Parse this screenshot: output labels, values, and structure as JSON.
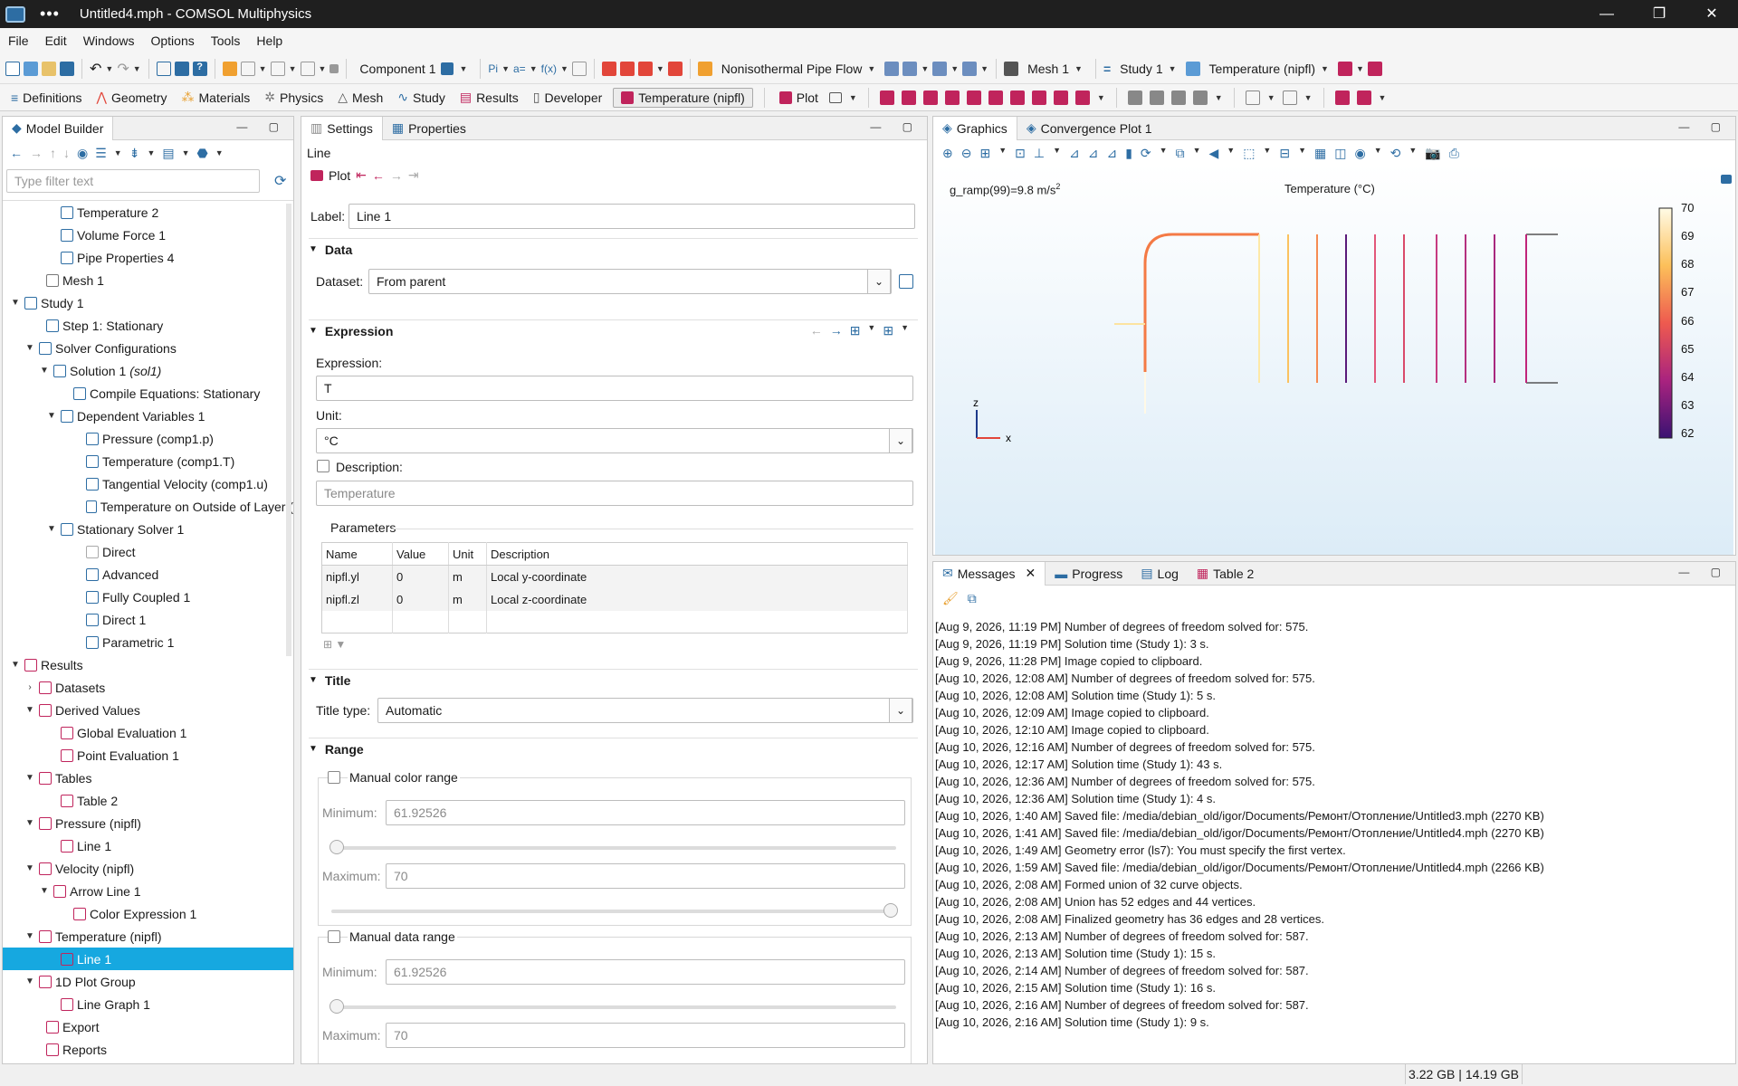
{
  "window": {
    "title": "Untitled4.mph - COMSOL Multiphysics",
    "dots": "•••",
    "min": "—",
    "max": "❐",
    "close": "✕"
  },
  "menu": [
    "File",
    "Edit",
    "Windows",
    "Options",
    "Tools",
    "Help"
  ],
  "toolbar": {
    "component": "Component 1",
    "physics": "Nonisothermal Pipe Flow",
    "mesh": "Mesh 1",
    "study": "Study 1",
    "plot": "Temperature (nipfl)"
  },
  "ribbon": {
    "tabs": [
      "Definitions",
      "Geometry",
      "Materials",
      "Physics",
      "Mesh",
      "Study",
      "Results",
      "Developer",
      "Temperature (nipfl)",
      "Plot"
    ]
  },
  "model_builder": {
    "title": "Model Builder",
    "filter_placeholder": "Type filter text",
    "nodes": [
      "Temperature 2",
      "Volume Force 1",
      "Pipe Properties 4",
      "Mesh 1",
      "Study 1",
      "Step 1: Stationary",
      "Solver Configurations",
      "Solution 1",
      "Compile Equations: Stationary",
      "Dependent Variables 1",
      "Pressure (comp1.p)",
      "Temperature (comp1.T)",
      "Tangential Velocity (comp1.u)",
      "Temperature on Outside of Layer (",
      "Stationary Solver 1",
      "Direct",
      "Advanced",
      "Fully Coupled 1",
      "Direct 1",
      "Parametric 1",
      "Results",
      "Datasets",
      "Derived Values",
      "Global Evaluation 1",
      "Point Evaluation 1",
      "Tables",
      "Table 2",
      "Pressure (nipfl)",
      "Line 1",
      "Velocity (nipfl)",
      "Arrow Line 1",
      "Color Expression 1",
      "Temperature (nipfl)",
      "Line 1",
      "1D Plot Group",
      "Line Graph 1",
      "Export",
      "Reports"
    ],
    "sol_tag": "(sol1)"
  },
  "settings": {
    "tabs": [
      "Settings",
      "Properties"
    ],
    "node_type": "Line",
    "plot_label": "Plot",
    "label_caption": "Label:",
    "label_value": "Line 1",
    "data_section": "Data",
    "dataset_caption": "Dataset:",
    "dataset_value": "From parent",
    "expression_section": "Expression",
    "expression_caption": "Expression:",
    "expression_value": "T",
    "unit_caption": "Unit:",
    "unit_value": "°C",
    "description_caption": "Description:",
    "description_value": "Temperature",
    "parameters_caption": "Parameters",
    "param_headers": [
      "Name",
      "Value",
      "Unit",
      "Description"
    ],
    "params": [
      [
        "nipfl.yl",
        "0",
        "m",
        "Local y-coordinate"
      ],
      [
        "nipfl.zl",
        "0",
        "m",
        "Local z-coordinate"
      ]
    ],
    "title_section": "Title",
    "title_type_caption": "Title type:",
    "title_type_value": "Automatic",
    "range_section": "Range",
    "manual_color_range": "Manual color range",
    "manual_data_range": "Manual data range",
    "min_caption": "Minimum:",
    "max_caption": "Maximum:",
    "min_value": "61.92526",
    "max_value": "70"
  },
  "graphics": {
    "tabs": [
      "Graphics",
      "Convergence Plot 1"
    ],
    "gravity_label": "g_ramp(99)=9.8 m/s",
    "gravity_exp": "2",
    "plot_title": "Temperature (°C)",
    "colorbar_ticks": [
      "70",
      "69",
      "68",
      "67",
      "66",
      "65",
      "64",
      "63",
      "62"
    ],
    "axis_z": "z",
    "axis_x": "x"
  },
  "messages": {
    "tabs": [
      "Messages",
      "Progress",
      "Log",
      "Table 2"
    ],
    "lines": [
      "[Aug 9, 2026, 11:19 PM] Number of degrees of freedom solved for: 575.",
      "[Aug 9, 2026, 11:19 PM] Solution time (Study 1): 3 s.",
      "[Aug 9, 2026, 11:28 PM] Image copied to clipboard.",
      "[Aug 10, 2026, 12:08 AM] Number of degrees of freedom solved for: 575.",
      "[Aug 10, 2026, 12:08 AM] Solution time (Study 1): 5 s.",
      "[Aug 10, 2026, 12:09 AM] Image copied to clipboard.",
      "[Aug 10, 2026, 12:10 AM] Image copied to clipboard.",
      "[Aug 10, 2026, 12:16 AM] Number of degrees of freedom solved for: 575.",
      "[Aug 10, 2026, 12:17 AM] Solution time (Study 1): 43 s.",
      "[Aug 10, 2026, 12:36 AM] Number of degrees of freedom solved for: 575.",
      "[Aug 10, 2026, 12:36 AM] Solution time (Study 1): 4 s.",
      "[Aug 10, 2026, 1:40 AM] Saved file: /media/debian_old/igor/Documents/Ремонт/Отопление/Untitled3.mph (2270 KB)",
      "[Aug 10, 2026, 1:41 AM] Saved file: /media/debian_old/igor/Documents/Ремонт/Отопление/Untitled4.mph (2270 KB)",
      "[Aug 10, 2026, 1:49 AM] Geometry error (ls7): You must specify the first vertex.",
      "[Aug 10, 2026, 1:59 AM] Saved file: /media/debian_old/igor/Documents/Ремонт/Отопление/Untitled4.mph (2266 KB)",
      "[Aug 10, 2026, 2:08 AM] Formed union of 32 curve objects.",
      "[Aug 10, 2026, 2:08 AM] Union has 52 edges and 44 vertices.",
      "[Aug 10, 2026, 2:08 AM] Finalized geometry has 36 edges and 28 vertices.",
      "[Aug 10, 2026, 2:13 AM] Number of degrees of freedom solved for: 587.",
      "[Aug 10, 2026, 2:13 AM] Solution time (Study 1): 15 s.",
      "[Aug 10, 2026, 2:14 AM] Number of degrees of freedom solved for: 587.",
      "[Aug 10, 2026, 2:15 AM] Solution time (Study 1): 16 s.",
      "[Aug 10, 2026, 2:16 AM] Number of degrees of freedom solved for: 587.",
      "[Aug 10, 2026, 2:16 AM] Solution time (Study 1): 9 s."
    ]
  },
  "status": {
    "memory": "3.22 GB | 14.19 GB"
  },
  "colors": {
    "accent": "#16a8e0",
    "brand": "#2d6da3",
    "results": "#c0245c"
  }
}
